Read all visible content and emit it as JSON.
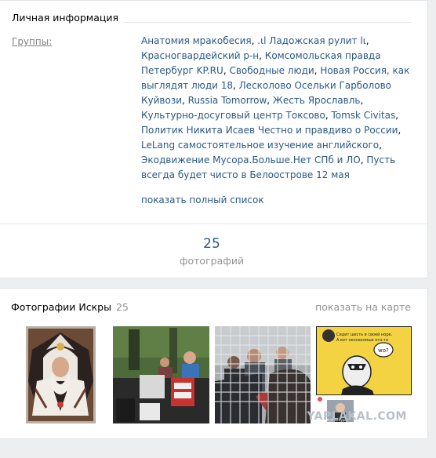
{
  "info": {
    "section_title": "Личная информация",
    "groups_label": "Группы:",
    "groups": [
      "Анатомия мракобесия",
      ".ιl Ладожская рулит lι",
      "Красногвардейский р-н",
      "Комсомольская правда Петербург KP.RU",
      "Свободные люди",
      "Новая Россия, как выглядят люди 18",
      "Лесколово Осельки Гарболово Куйвози",
      "Russia Tomorrow",
      "Жесть Ярославль",
      "Культурно-досуговый центр Токсово",
      "Tomsk Civitas",
      "Политик Никита Исаев Честно и правдиво о России",
      "LeLang самостоятельное изучение английского",
      "Экодвижение Мусора.Больше.Нет СПб и ЛО",
      "Пусть всегда будет чисто в Белоострове 12 мая"
    ],
    "show_all": "показать полный список",
    "photo_count": "25",
    "photo_count_label": "фотографий"
  },
  "photos": {
    "title": "Фотографии Искры",
    "count": "25",
    "show_on_map": "показать на карте",
    "thumbnails": [
      {
        "subject": "icon-painting"
      },
      {
        "subject": "street-stall"
      },
      {
        "subject": "caged-crowd"
      },
      {
        "subject": "cartoon"
      }
    ],
    "cartoon_text": "Сидит шесть в своей норе. А вот незнакомые кто-то",
    "cartoon_bubble": "wo?",
    "cartoon_caption": "Кто-то курит"
  },
  "watermark": "YAPLAKAL.COM"
}
